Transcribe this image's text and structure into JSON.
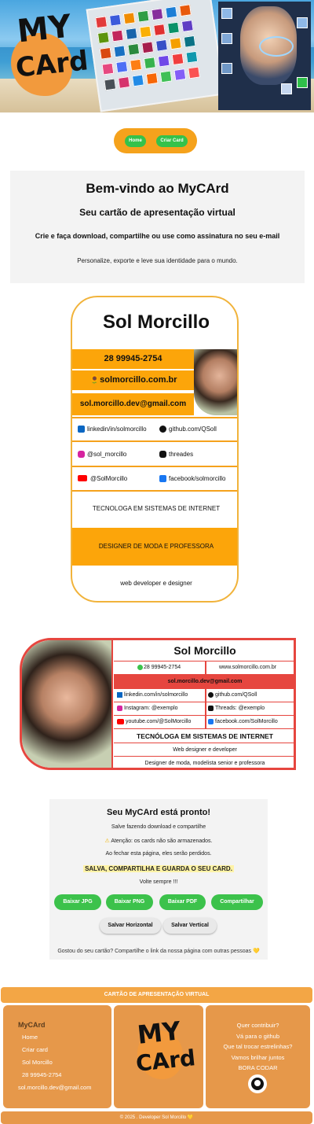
{
  "banner": {
    "logo_top": "MY",
    "logo_bottom": "CArd"
  },
  "nav": {
    "home": "Home",
    "criar": "Criar Card"
  },
  "welcome": {
    "title": "Bem-vindo ao MyCArd",
    "subtitle": "Seu cartão de apresentação virtual",
    "headline": "Crie e faça download, compartilhe ou use como assinatura no seu e-mail",
    "tagline": "Personalize, exporte e leve sua identidade para o mundo."
  },
  "vertical_card": {
    "name": "Sol Morcillo",
    "phone": "28 99945-2754",
    "website": "🌻solmorcillo.com.br",
    "email": "sol.morcillo.dev@gmail.com",
    "linkedin": "linkedin/in/solmorcillo",
    "github": "github.com/QSoll",
    "instagram": "@sol_morcillo",
    "threads": "threades",
    "youtube": "@SolMorcillo",
    "facebook": "facebook/solmorcillo",
    "title1": "TECNOLOGA EM SISTEMAS DE INTERNET",
    "title2": "DESIGNER DE MODA E PROFESSORA",
    "footer": "web developer e designer"
  },
  "horizontal_card": {
    "name": "Sol Morcillo",
    "phone": "28 99945-2754",
    "website": "www.solmorcillo.com.br",
    "email": "sol.morcillo.dev@gmail.com",
    "linkedin": "linkedin.com/in/solmorcillo",
    "github": "github.com/QSoll",
    "instagram": "Instagram: @exemplo",
    "threads": "Threads: @exemplo",
    "youtube": "youtube.com/@SolMorcillo",
    "facebook": "facebook.com/SolMorcillo",
    "title": "TECNÓLOGA EM SISTEMAS DE INTERNET",
    "line1": "Web designer e developer",
    "line2": "Designer de moda, modelista senior e professora"
  },
  "ready": {
    "title": "Seu MyCArd está pronto!",
    "line1": "Salve fazendo download e compartilhe",
    "warning": "Atenção: os cards não são armazenados.",
    "line3": "Ao fechar esta página, eles serão perdidos.",
    "highlight": "SALVA, COMPARTILHA E GUARDA O SEU CARD.",
    "line5": "Volte sempre !!!",
    "btn_jpg": "Baixar JPG",
    "btn_png": "Baixar PNG",
    "btn_pdf": "Baixar PDF",
    "btn_share": "Compartilhar",
    "btn_horizontal": "Salvar Horizontal",
    "btn_vertical": "Salvar Vertical",
    "share_prompt": "Gostou do seu cartão? Compartilhe o link da nossa página com outras pessoas 💛"
  },
  "footer": {
    "bar_title": "CARTÃO DE APRESENTAÇÃO VIRTUAL",
    "left": {
      "title": "MyCArd",
      "items": [
        "Home",
        "Criar card",
        "Sol Morcillo",
        "28 99945-2754"
      ],
      "email": "sol.morcillo.dev@gmail.com"
    },
    "right": {
      "items": [
        "Quer contribuir?",
        "Vá para o github",
        "Que tal trocar estrelinhas?",
        "Vamos brilhar juntos",
        "BORA CODAR"
      ]
    },
    "logo_top": "MY",
    "logo_bottom": "CArd",
    "copyright": "© 2025 . Developer Sol Morcillo 💛"
  },
  "colors": {
    "orange": "#fca50a",
    "green": "#3cc24b",
    "red": "#e6463f",
    "footer_orange": "#e6984a"
  }
}
